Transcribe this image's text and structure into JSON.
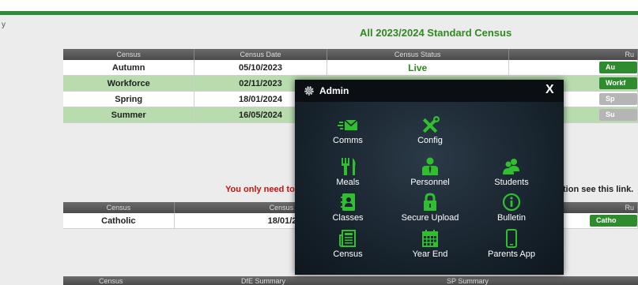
{
  "corner_text": "y",
  "page_title": "All 2023/2024 Standard Census",
  "census_table": {
    "headers": [
      "Census",
      "Census Date",
      "Census Status",
      "Ru"
    ],
    "rows": [
      {
        "census": "Autumn",
        "date": "05/10/2023",
        "status": "Live",
        "run": "Au"
      },
      {
        "census": "Workforce",
        "date": "02/11/2023",
        "status": "",
        "run": "Workf"
      },
      {
        "census": "Spring",
        "date": "18/01/2024",
        "status": "",
        "run": "Sp"
      },
      {
        "census": "Summer",
        "date": "16/05/2024",
        "status": "",
        "run": "Su"
      }
    ]
  },
  "notice": {
    "left": "You only need to co",
    "right": "tion see this link."
  },
  "catholic_table": {
    "headers": [
      "Census",
      "Census Date",
      "Ru"
    ],
    "rows": [
      {
        "census": "Catholic",
        "date": "18/01/2024",
        "run": "Catho"
      }
    ]
  },
  "bottom_headers": [
    "Census",
    "DfE Summary",
    "SP Summary"
  ],
  "admin_modal": {
    "title": "Admin",
    "close": "X",
    "items": [
      {
        "label": "Comms",
        "icon": "envelope-icon"
      },
      {
        "label": "Config",
        "icon": "tools-icon"
      },
      {
        "label": "Meals",
        "icon": "cutlery-icon"
      },
      {
        "label": "Personnel",
        "icon": "person-tie-icon"
      },
      {
        "label": "Students",
        "icon": "students-icon"
      },
      {
        "label": "Classes",
        "icon": "contact-book-icon"
      },
      {
        "label": "Secure Upload",
        "icon": "lock-icon"
      },
      {
        "label": "Bulletin",
        "icon": "info-circle-icon"
      },
      {
        "label": "Census",
        "icon": "newspaper-icon"
      },
      {
        "label": "Year End",
        "icon": "calendar-icon"
      },
      {
        "label": "Parents App",
        "icon": "mobile-phone-icon"
      }
    ]
  },
  "colors": {
    "accent_green": "#2d8a1f",
    "row_green": "#b8dcae",
    "icon_green": "#2fbf2f",
    "notice_red": "#cc1111"
  }
}
